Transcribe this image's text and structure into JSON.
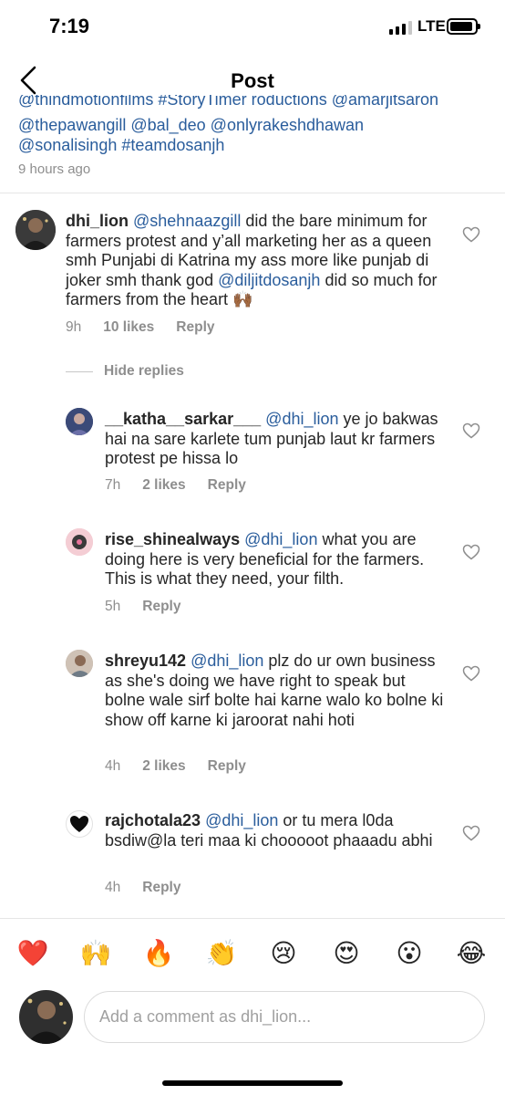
{
  "status_bar": {
    "time": "7:19",
    "network": "LTE"
  },
  "nav": {
    "title": "Post"
  },
  "caption": {
    "cut_line": "@thindmotionfilms #StoryTimer roductions @amarjitsaron",
    "line1": "@thepawangill  @bal_deo @onlyrakeshdhawan",
    "line2": "@sonalisingh #teamdosanjh",
    "time": "9 hours ago"
  },
  "main_comment": {
    "username": "dhi_lion",
    "mention1": "@shehnaazgill",
    "text1": " did the bare minimum for farmers protest and y’all marketing her as a queen smh Punjabi di Katrina my ass more like punjab di joker smh thank god ",
    "mention2": "@diljitdosanjh",
    "text2": " did so much for farmers from the heart 🙌🏾",
    "time": "9h",
    "likes": "10 likes",
    "reply": "Reply"
  },
  "hide_replies": "Hide replies",
  "replies": [
    {
      "username": "__katha__sarkar___",
      "mention": "@dhi_lion",
      "text": " ye jo bakwas hai na sare karlete tum punjab laut kr farmers protest pe hissa lo",
      "time": "7h",
      "likes": "2 likes",
      "reply": "Reply"
    },
    {
      "username": "rise_shinealways",
      "mention": "@dhi_lion",
      "text": " what you are doing here is very beneficial for the farmers. This is what they need, your filth.",
      "time": "5h",
      "likes": "",
      "reply": "Reply"
    },
    {
      "username": "shreyu142",
      "mention": "@dhi_lion",
      "text": " plz do ur own business as she's doing we have right to speak but bolne wale sirf bolte hai karne walo ko bolne ki show off karne ki jaroorat nahi hoti",
      "time": "4h",
      "likes": "2 likes",
      "reply": "Reply"
    },
    {
      "username": "rajchotala23",
      "mention": "@dhi_lion",
      "text": " or tu mera l0da bsdiw@la teri maa ki chooooot phaaadu abhi",
      "time": "4h",
      "likes": "",
      "reply": "Reply"
    }
  ],
  "emoji_bar": [
    "❤️",
    "🙌",
    "🔥",
    "👏",
    "😢",
    "😍",
    "😮",
    "😂"
  ],
  "composer": {
    "placeholder": "Add a comment as dhi_lion..."
  }
}
